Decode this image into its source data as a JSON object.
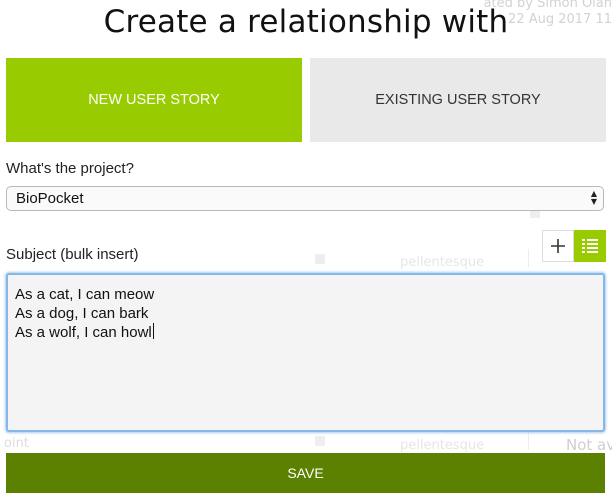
{
  "background": {
    "author_line": "ated by Simon Olan",
    "date_line": "22 Aug 2017 11",
    "row_text_1": "pellentesque",
    "row_text_2": "pellentesque",
    "status_text": "Not av",
    "point_text": "oint"
  },
  "modal": {
    "title": "Create a relationship with",
    "tabs": [
      {
        "label": "NEW USER STORY",
        "active": true
      },
      {
        "label": "EXISTING USER STORY",
        "active": false
      }
    ],
    "project": {
      "label": "What's the project?",
      "selected": "BioPocket"
    },
    "subject": {
      "label": "Subject (bulk insert)",
      "lines": [
        "As a cat, I can meow",
        "As a dog, I can bark",
        "As a wolf, I can howl"
      ]
    },
    "save_label": "SAVE"
  },
  "colors": {
    "accent": "#99cc00",
    "save": "#5c8100",
    "tab_inactive": "#e9e9e9",
    "focus": "#86b7e7"
  },
  "icons": {
    "add": "plus-icon",
    "bulk": "list-icon",
    "select": "select-arrows-icon"
  }
}
